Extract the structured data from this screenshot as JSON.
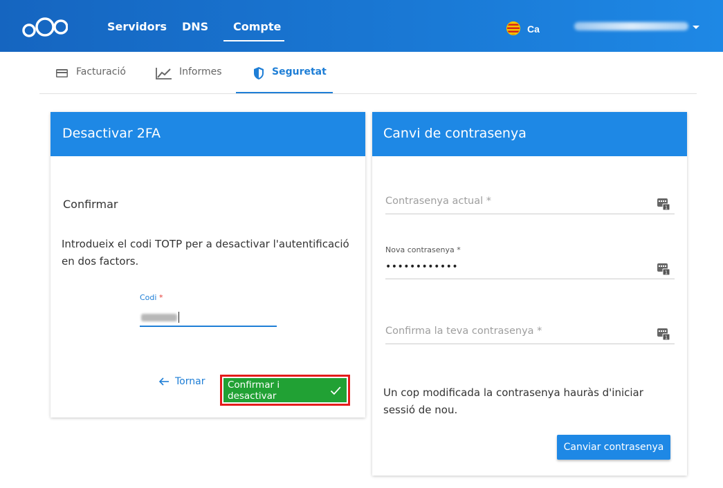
{
  "header": {
    "logo": "nextcloud-logo",
    "nav": [
      {
        "label": "Servidors"
      },
      {
        "label": "DNS"
      },
      {
        "label": "Compte",
        "active": true
      }
    ],
    "language": "Ca",
    "flag": "catalan-flag"
  },
  "tabs": [
    {
      "label": "Facturació",
      "icon": "credit-card-icon"
    },
    {
      "label": "Informes",
      "icon": "chart-line-icon"
    },
    {
      "label": "Seguretat",
      "icon": "shield-icon",
      "active": true
    }
  ],
  "disable2fa": {
    "title": "Desactivar 2FA",
    "subtitle": "Confirmar",
    "description": "Introdueix el codi TOTP per a desactivar l'autentificació en dos factors.",
    "code_label": "Codi",
    "required_mark": "*",
    "back_label": "Tornar",
    "confirm_label": "Confirmar i desactivar"
  },
  "password": {
    "title": "Canvi de contrasenya",
    "current_placeholder": "Contrasenya actual *",
    "new_label": "Nova contrasenya *",
    "new_value": "••••••••••••",
    "confirm_placeholder": "Confirma la teva contrasenya *",
    "info": "Un cop modificada la contrasenya hauràs d'iniciar sessió de nou.",
    "submit_label": "Canviar contrasenya"
  },
  "colors": {
    "primary": "#1e88e5",
    "confirm": "#21a134",
    "highlight": "#e41b1b"
  }
}
